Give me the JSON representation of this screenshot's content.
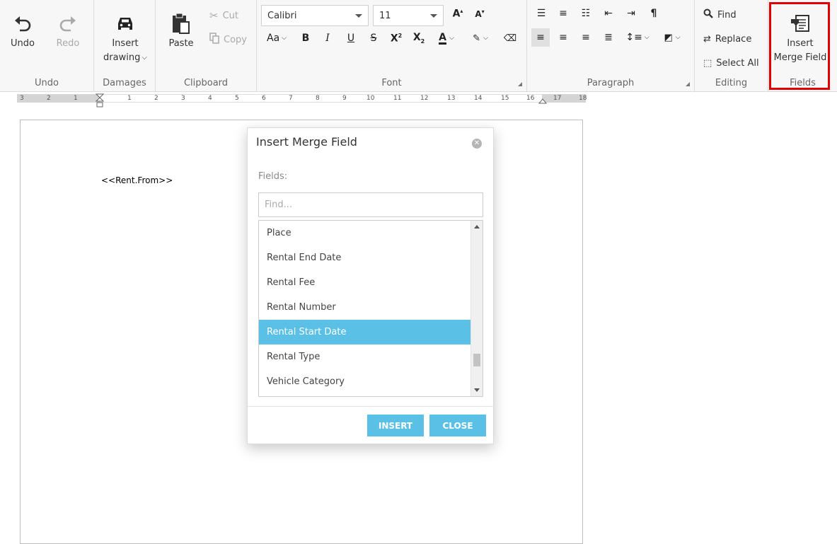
{
  "ribbon": {
    "undo_group": {
      "label": "Undo",
      "undo": "Undo",
      "redo": "Redo"
    },
    "damages_group": {
      "label": "Damages",
      "insert_drawing_line1": "Insert",
      "insert_drawing_line2": "drawing"
    },
    "clipboard_group": {
      "label": "Clipboard",
      "paste": "Paste",
      "cut": "Cut",
      "copy": "Copy"
    },
    "font_group": {
      "label": "Font",
      "font_name": "Calibri",
      "font_size": "11",
      "change_case": "Aa"
    },
    "paragraph_group": {
      "label": "Paragraph"
    },
    "editing_group": {
      "label": "Editing",
      "find": "Find",
      "replace": "Replace",
      "select_all": "Select All"
    },
    "fields_group": {
      "label": "Fields",
      "insert_merge_line1": "Insert",
      "insert_merge_line2": "Merge Field"
    }
  },
  "ruler": {
    "numbers": [
      "3",
      "2",
      "1",
      "1",
      "2",
      "3",
      "4",
      "5",
      "6",
      "7",
      "8",
      "9",
      "10",
      "11",
      "12",
      "13",
      "14",
      "15",
      "16",
      "17",
      "18"
    ]
  },
  "document": {
    "field_text": "<<Rent.From>>"
  },
  "dialog": {
    "title": "Insert Merge Field",
    "fields_label": "Fields:",
    "find_placeholder": "Find...",
    "items": [
      "Place",
      "Rental End Date",
      "Rental Fee",
      "Rental Number",
      "Rental Start Date",
      "Rental Type",
      "Vehicle Category"
    ],
    "selected_item": "Rental Start Date",
    "insert_label": "INSERT",
    "close_label": "CLOSE"
  },
  "colors": {
    "accent": "#5bc0e6",
    "highlight": "#e00000"
  }
}
